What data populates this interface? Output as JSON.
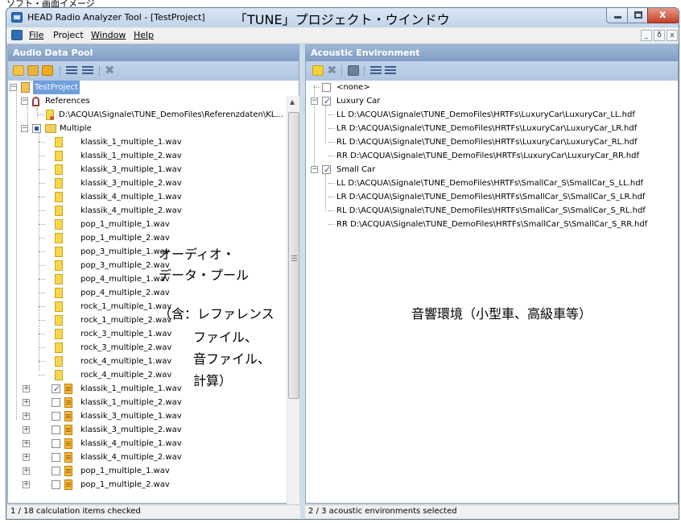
{
  "top_caption": "ソフト・画面イメージ",
  "window": {
    "title": "HEAD Radio Analyzer Tool - [TestProject]",
    "annotation_title": "「TUNE」プロジェクト・ウインドウ",
    "controls": {
      "minimize": "_",
      "maximize": "□",
      "close": "x"
    }
  },
  "menu": {
    "items": [
      "File",
      "Project",
      "Window",
      "Help"
    ],
    "mdi_controls": [
      "_",
      "ð",
      "x"
    ]
  },
  "left_panel": {
    "title": "Audio Data Pool",
    "tree": {
      "project": "TestProject",
      "references": "References",
      "reference_file": "D:\\ACQUA\\Signale\\TUNE_DemoFiles\\Referenzdaten\\KL...",
      "multiple": "Multiple",
      "files": [
        "klassik_1_multiple_1.wav",
        "klassik_1_multiple_2.wav",
        "klassik_3_multiple_1.wav",
        "klassik_3_multiple_2.wav",
        "klassik_4_multiple_1.wav",
        "klassik_4_multiple_2.wav",
        "pop_1_multiple_1.wav",
        "pop_1_multiple_2.wav",
        "pop_3_multiple_1.wav",
        "pop_3_multiple_2.wav",
        "pop_4_multiple_1.wav",
        "pop_4_multiple_2.wav",
        "rock_1_multiple_1.wav",
        "rock_1_multiple_2.wav",
        "rock_3_multiple_1.wav",
        "rock_3_multiple_2.wav",
        "rock_4_multiple_1.wav",
        "rock_4_multiple_2.wav"
      ],
      "calculations": [
        {
          "name": "klassik_1_multiple_1.wav",
          "checked": true
        },
        {
          "name": "klassik_1_multiple_2.wav",
          "checked": false
        },
        {
          "name": "klassik_3_multiple_1.wav",
          "checked": false
        },
        {
          "name": "klassik_3_multiple_2.wav",
          "checked": false
        },
        {
          "name": "klassik_4_multiple_1.wav",
          "checked": false
        },
        {
          "name": "klassik_4_multiple_2.wav",
          "checked": false
        },
        {
          "name": "pop_1_multiple_1.wav",
          "checked": false
        },
        {
          "name": "pop_1_multiple_2.wav",
          "checked": false
        }
      ]
    },
    "annotation_lines": [
      "オーディオ・",
      "データ・プール",
      "（含：レファレンス",
      "ファイル、",
      "音ファイル、",
      "計算）"
    ],
    "status": "1 / 18 calculation items checked"
  },
  "right_panel": {
    "title": "Acoustic Environment",
    "tree": {
      "none": "<none>",
      "luxury": {
        "label": "Luxury Car",
        "items": [
          "LL  D:\\ACQUA\\Signale\\TUNE_DemoFiles\\HRTFs\\LuxuryCar\\LuxuryCar_LL.hdf",
          "LR  D:\\ACQUA\\Signale\\TUNE_DemoFiles\\HRTFs\\LuxuryCar\\LuxuryCar_LR.hdf",
          "RL  D:\\ACQUA\\Signale\\TUNE_DemoFiles\\HRTFs\\LuxuryCar\\LuxuryCar_RL.hdf",
          "RR  D:\\ACQUA\\Signale\\TUNE_DemoFiles\\HRTFs\\LuxuryCar\\LuxuryCar_RR.hdf"
        ]
      },
      "small": {
        "label": "Small Car",
        "items": [
          "LL  D:\\ACQUA\\Signale\\TUNE_DemoFiles\\HRTFs\\SmallCar_S\\SmallCar_S_LL.hdf",
          "LR  D:\\ACQUA\\Signale\\TUNE_DemoFiles\\HRTFs\\SmallCar_S\\SmallCar_S_LR.hdf",
          "RL  D:\\ACQUA\\Signale\\TUNE_DemoFiles\\HRTFs\\SmallCar_S\\SmallCar_S_RL.hdf",
          "RR  D:\\ACQUA\\Signale\\TUNE_DemoFiles\\HRTFs\\SmallCar_S\\SmallCar_S_RR.hdf"
        ]
      }
    },
    "annotation": "音響環境（小型車、高級車等）",
    "status": "2 / 3 acoustic environments selected"
  }
}
